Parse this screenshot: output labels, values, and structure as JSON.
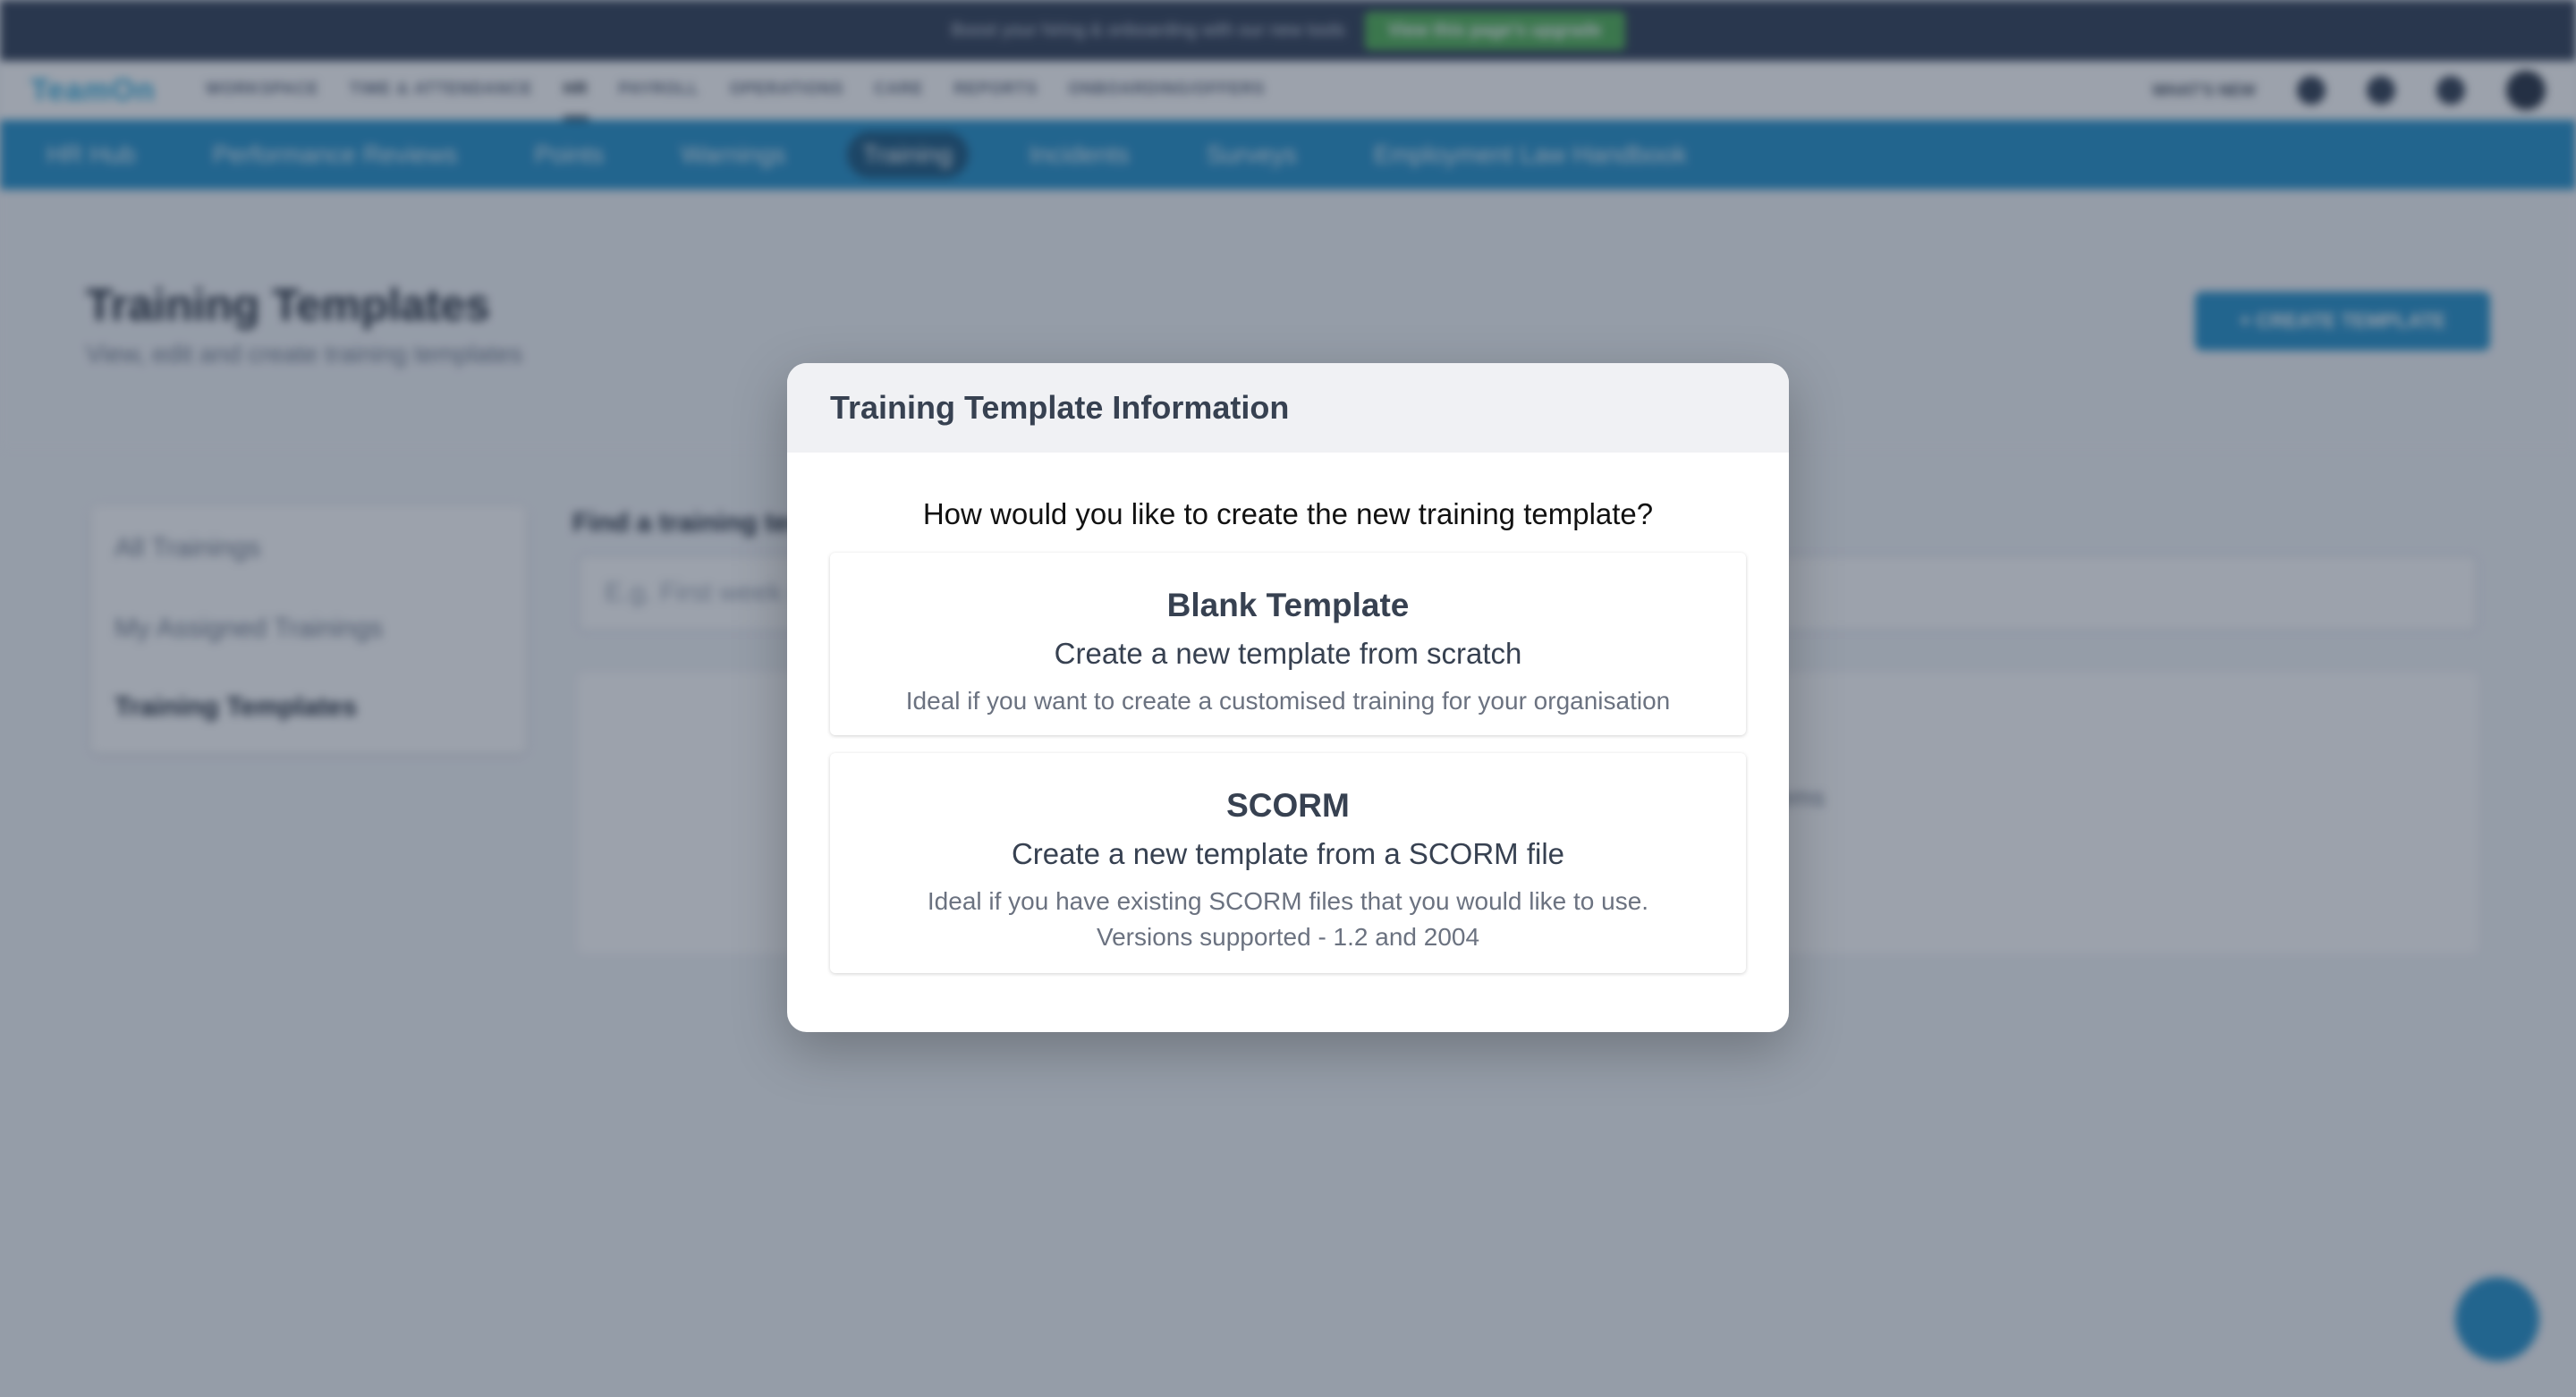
{
  "colors": {
    "accent": "#1f8ec8",
    "promo_button": "#4caf50",
    "overlay": "rgba(40,52,74,0.46)"
  },
  "promo": {
    "text": "Boost your hiring & onboarding with our new tools",
    "button": "View this page's upgrade"
  },
  "topnav": {
    "logo": "TeamOn",
    "items": [
      "WORKSPACE",
      "TIME & ATTENDANCE",
      "HR",
      "PAYROLL",
      "OPERATIONS",
      "CARE",
      "REPORTS",
      "ONBOARDING/OFFERS"
    ],
    "active_item": "HR",
    "right_label": "WHAT'S NEW"
  },
  "subnav": {
    "items": [
      "HR Hub",
      "Performance Reviews",
      "Points",
      "Warnings",
      "Training",
      "Incidents",
      "Surveys",
      "Employment Law Handbook"
    ],
    "active_item": "Training"
  },
  "page": {
    "title": "Training Templates",
    "subtitle": "View, edit and create training templates",
    "create_button": "+ CREATE TEMPLATE"
  },
  "sidebar": {
    "items": [
      "All Trainings",
      "My Assigned Trainings",
      "Training Templates"
    ],
    "selected": "Training Templates"
  },
  "search": {
    "label": "Find a training template",
    "placeholder": "E.g. First week onboarding"
  },
  "empty_state": {
    "text": "0 items"
  },
  "modal": {
    "title": "Training Template Information",
    "question": "How would you like to create the new training template?",
    "options": [
      {
        "title": "Blank Template",
        "subtitle": "Create a new template from scratch",
        "description": "Ideal if you want to create a customised training for your organisation"
      },
      {
        "title": "SCORM",
        "subtitle": "Create a new template from a SCORM file",
        "description": "Ideal if you have existing SCORM files that you would like to use.",
        "description2": "Versions supported - 1.2 and 2004"
      }
    ]
  }
}
